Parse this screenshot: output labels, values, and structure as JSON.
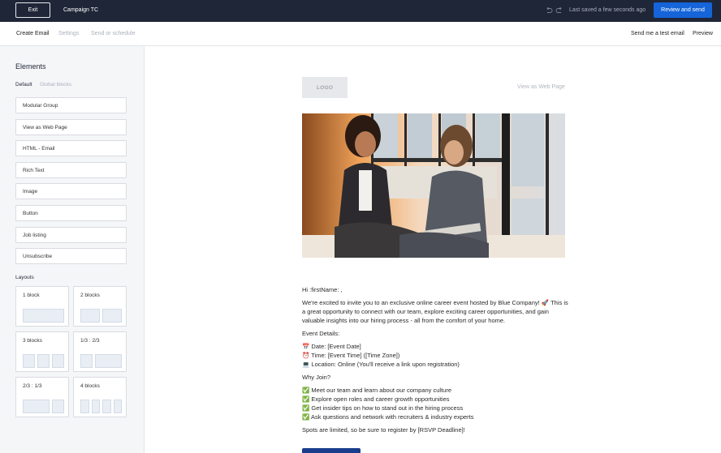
{
  "topbar": {
    "exit_label": "Exit",
    "campaign_title": "Campaign TC",
    "saved_status": "Last saved a few seconds ago",
    "review_label": "Review and send",
    "undo_icon": "undo-icon",
    "redo_icon": "redo-icon"
  },
  "subnav": {
    "tabs": [
      "Create Email",
      "Settings",
      "Send or schedule"
    ],
    "test_email_label": "Send me a test email",
    "preview_label": "Preview"
  },
  "sidebar": {
    "heading": "Elements",
    "tab_default": "Default",
    "tab_global": "Global blocks",
    "blocks": [
      "Modular Group",
      "View as Web Page",
      "HTML - Email",
      "Rich Text",
      "Image",
      "Button",
      "Job listing",
      "Unsubscribe"
    ],
    "layouts_heading": "Layouts",
    "layouts": [
      {
        "label": "1 block"
      },
      {
        "label": "2 blocks"
      },
      {
        "label": "3 blocks"
      },
      {
        "label": "1/3 : 2/3"
      },
      {
        "label": "2/3 : 1/3"
      },
      {
        "label": "4 blocks"
      }
    ]
  },
  "email": {
    "logo_text": "LOGO",
    "webpage_link": "View as Web Page",
    "greeting": "Hi :firstName: ,",
    "intro": "We're excited to invite you to an exclusive online career event hosted by Blue Company! 🚀 This is a great opportunity to connect with our team, explore exciting career opportunities, and gain valuable insights into our hiring process - all from the comfort of your home.",
    "details_heading": "Event Details:",
    "detail_date": "📅 Date: [Event Date]",
    "detail_time": "⏰ Time: [Event Time] ([Time Zone])",
    "detail_location": "💻 Location: Online (You'll receive a link upon registration)",
    "why_heading": "Why Join?",
    "why_1": "✅ Meet our team and learn about our company culture",
    "why_2": "✅ Explore open roles and career growth opportunities",
    "why_3": "✅ Get insider tips on how to stand out in the hiring process",
    "why_4": "✅ Ask questions and network with recruiters & industry experts",
    "closing": "Spots are limited, so be sure to register by [RSVP Deadline]!"
  },
  "colors": {
    "topbar_bg": "#1f2637",
    "primary": "#1564d9",
    "sidebar_bg": "#f5f6f8"
  }
}
